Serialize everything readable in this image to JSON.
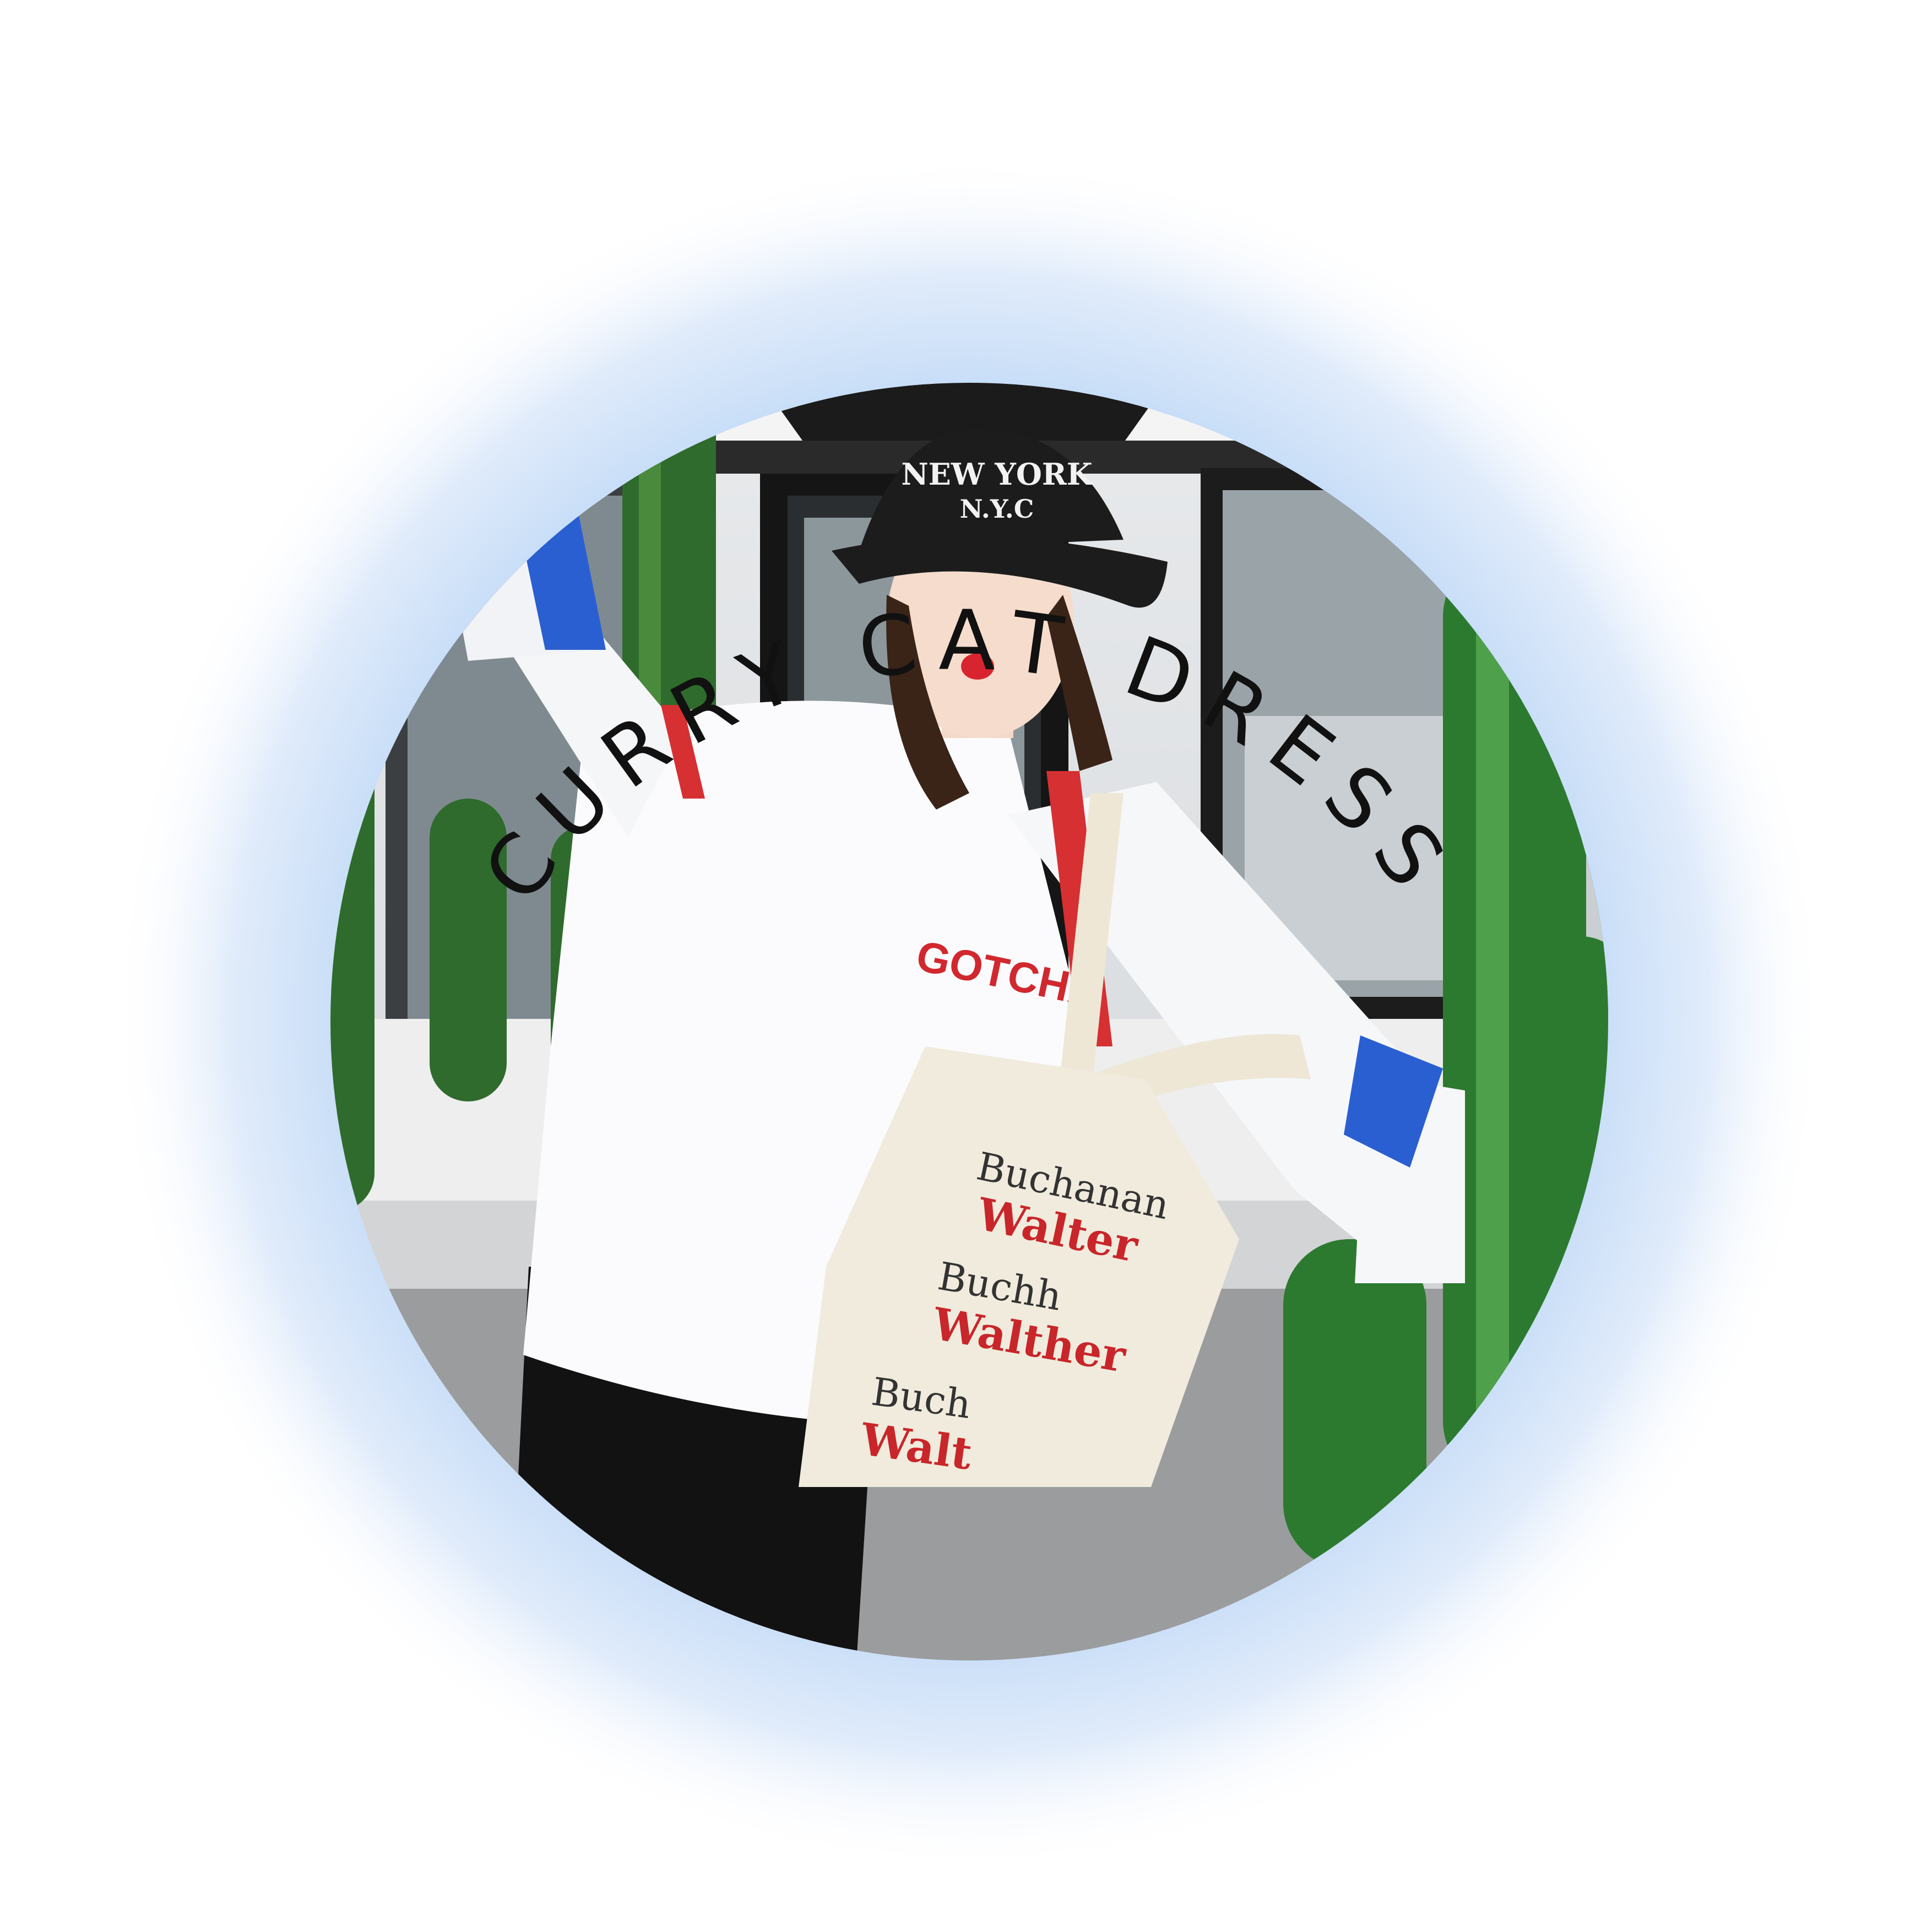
{
  "brand": {
    "title": "CURRY CAT DRESS",
    "glow_color": "#c5dcf7",
    "text_color": "#111111"
  },
  "photo": {
    "hat_text_line1": "NEW YORK",
    "hat_text_line2": "N.Y.C",
    "shirt_text": "GOTCHA",
    "bag_words": [
      "Buchanan",
      "Walter",
      "Buchh",
      "Walther",
      "Buch",
      "Walt"
    ]
  }
}
